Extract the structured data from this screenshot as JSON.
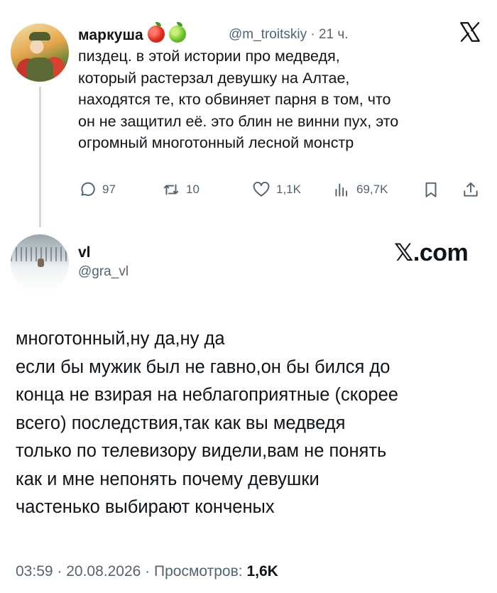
{
  "quoted_tweet": {
    "display_name": "маркуша",
    "emojis": [
      "red-apple-icon",
      "green-apple-icon"
    ],
    "handle": "@m_troitskiy",
    "time": "· 21 ч.",
    "text": "пиздец. в этой истории про медведя,\nкоторый растерзал девушку на Алтае,\nнаходятся те, кто обвиняет парня в том, что\nон не защитил её. это блин не винни пух, это\nогромный многотонный лесной монстр",
    "actions": {
      "replies": "97",
      "retweets": "10",
      "likes": "1,1K",
      "views": "69,7K"
    }
  },
  "reply_tweet": {
    "display_name": "vl",
    "handle": "@gra_vl",
    "site_label": "𝕏.com",
    "text": "многотонный,ну да,ну да\nесли бы мужик был не гавно,он бы бился до\nконца не взирая на неблагоприятные (скорее\nвсего) последствия,так как вы медведя\nтолько по телевизору видели,вам не понять\nкак и мне непонять почему девушки\nчастенько выбирают конченых",
    "meta": {
      "time": "03:59",
      "date": "20.08.2026",
      "views_label": "Просмотров:",
      "views_count": "1,6K"
    }
  },
  "colors": {
    "text": "#0f1419",
    "secondary": "#536471",
    "thread_line": "#cfd9de"
  }
}
